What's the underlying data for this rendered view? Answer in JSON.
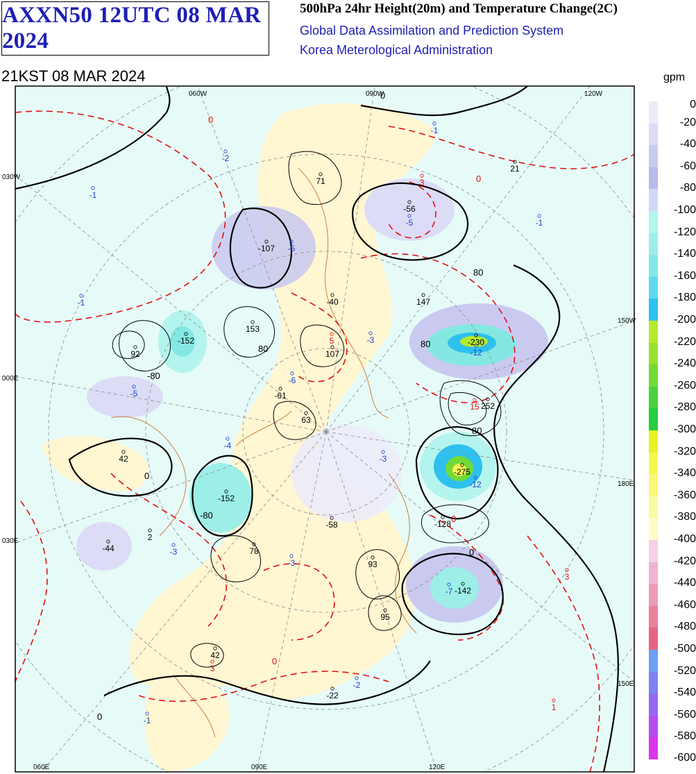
{
  "header": {
    "product_code": "AXXN50 12UTC 08 MAR 2024",
    "title": "500hPa 24hr Height(20m) and Temperature Change(2C)",
    "subtitle_line1": "Global Data Assimilation and Prediction System",
    "subtitle_line2": "Korea Meterological Administration",
    "valid_time": "21KST 08 MAR 2024"
  },
  "colors": {
    "title_blue": "#1f1fb4",
    "height_contour": "#000000",
    "temp_contour": "#e01010",
    "coastline": "#d08040",
    "land": "#fff6d2",
    "ocean": "#e6fbf8"
  },
  "map_labels": {
    "lon_top": [
      "060W",
      "090W",
      "120W"
    ],
    "lon_bottom": [
      "060E",
      "090E",
      "120E"
    ],
    "lat_left": [
      "030W",
      "000E",
      "030E"
    ],
    "lat_right": [
      "150W",
      "180E",
      "150E"
    ]
  },
  "height_change_centers": [
    {
      "v": "71"
    },
    {
      "v": "-56"
    },
    {
      "v": "21"
    },
    {
      "v": "-107"
    },
    {
      "v": "-40"
    },
    {
      "v": "147"
    },
    {
      "v": "153"
    },
    {
      "v": "-152"
    },
    {
      "v": "92"
    },
    {
      "v": "107"
    },
    {
      "v": "-230"
    },
    {
      "v": "-61"
    },
    {
      "v": "252"
    },
    {
      "v": "63"
    },
    {
      "v": "42"
    },
    {
      "v": "-275"
    },
    {
      "v": "-152"
    },
    {
      "v": "-58"
    },
    {
      "v": "-128"
    },
    {
      "v": "2"
    },
    {
      "v": "-44"
    },
    {
      "v": "78"
    },
    {
      "v": "93"
    },
    {
      "v": "-142"
    },
    {
      "v": "95"
    },
    {
      "v": "42"
    },
    {
      "v": "-22"
    }
  ],
  "temperature_change_centers": [
    {
      "v": "-1"
    },
    {
      "v": "-2"
    },
    {
      "v": "-1"
    },
    {
      "v": "3"
    },
    {
      "v": "-5"
    },
    {
      "v": "-1"
    },
    {
      "v": "-5"
    },
    {
      "v": "-3"
    },
    {
      "v": "-1"
    },
    {
      "v": "5"
    },
    {
      "v": "-12"
    },
    {
      "v": "-6"
    },
    {
      "v": "-5"
    },
    {
      "v": "15"
    },
    {
      "v": "-4"
    },
    {
      "v": "-3"
    },
    {
      "v": "-12"
    },
    {
      "v": "-3"
    },
    {
      "v": "-3"
    },
    {
      "v": "-7"
    },
    {
      "v": "3"
    },
    {
      "v": "-2"
    },
    {
      "v": "3"
    },
    {
      "v": "1"
    },
    {
      "v": "-1"
    }
  ],
  "contour_labels": {
    "zero": "0",
    "height_80": "80",
    "height_m80": "-80",
    "height_0": "0"
  },
  "legend": {
    "unit": "gpm",
    "labels": [
      "0",
      "-20",
      "-40",
      "-60",
      "-80",
      "-100",
      "-120",
      "-140",
      "-160",
      "-180",
      "-200",
      "-220",
      "-240",
      "-260",
      "-280",
      "-300",
      "-320",
      "-340",
      "-360",
      "-380",
      "-400",
      "-420",
      "-440",
      "-460",
      "-480",
      "-500",
      "-520",
      "-540",
      "-560",
      "-580",
      "-600"
    ],
    "colors": [
      "#ececf9",
      "#dcdcf6",
      "#cacaf1",
      "#b9b9ec",
      "#cfd8f4",
      "#b4f4ee",
      "#9deee8",
      "#84e8e2",
      "#5fd8f0",
      "#2ec0ee",
      "#b6ea30",
      "#96e230",
      "#72da36",
      "#4cd23c",
      "#28cc40",
      "#e8f028",
      "#f6f650",
      "#f8f878",
      "#fafaa0",
      "#fcfcc8",
      "#f4d2e6",
      "#f0b4d0",
      "#ec9ab8",
      "#e8809e",
      "#e46684",
      "#6ca0f6",
      "#7e82f4",
      "#9868f0",
      "#b44eec",
      "#d838ec"
    ]
  }
}
